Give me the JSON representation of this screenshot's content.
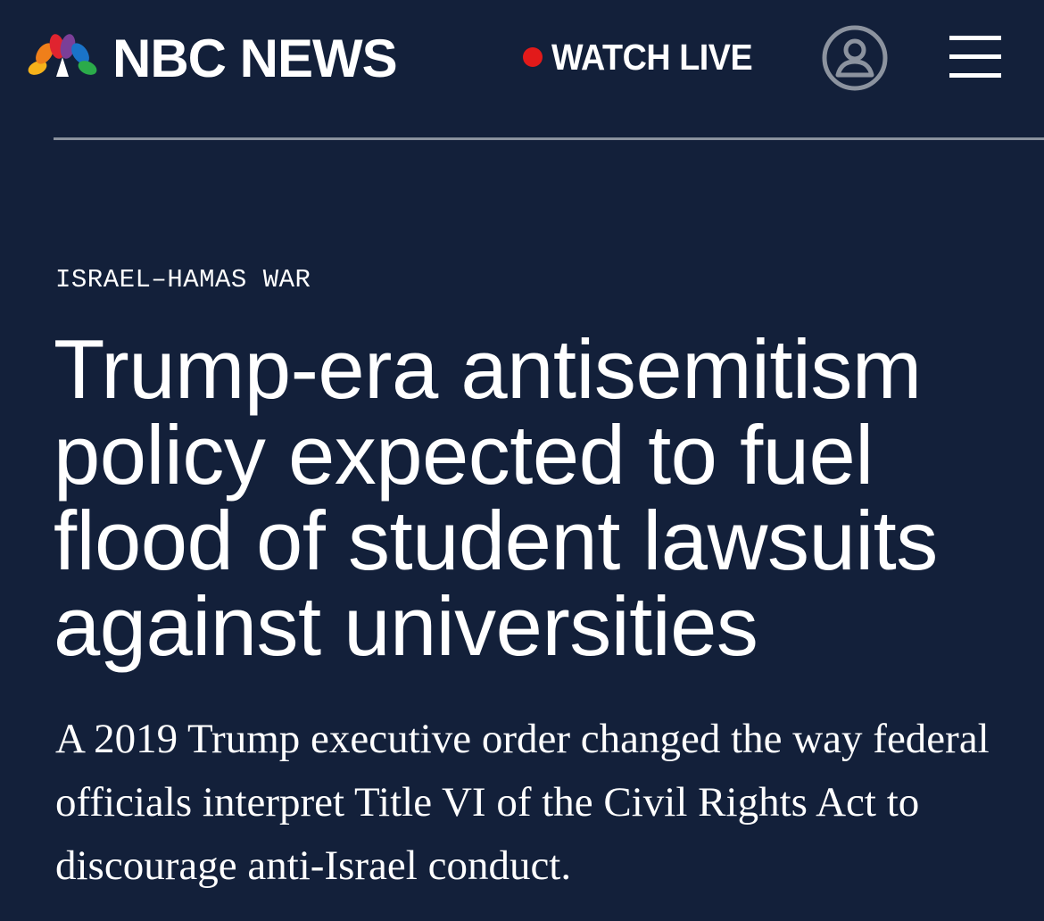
{
  "header": {
    "brand": "NBC NEWS",
    "watch_live_label": "WATCH LIVE",
    "account_icon": "user-account-icon",
    "menu_icon": "hamburger-menu-icon",
    "colors": {
      "background": "#13203a",
      "live_dot": "#e21a1a",
      "divider": "#8a919d"
    }
  },
  "article": {
    "section": "ISRAEL–HAMAS WAR",
    "headline": "Trump-era antisemitism policy expected to fuel flood of student lawsuits against universities",
    "dek": "A 2019 Trump executive order changed the way federal officials interpret Title VI of the Civil Rights Act to discourage anti-Israel conduct."
  }
}
